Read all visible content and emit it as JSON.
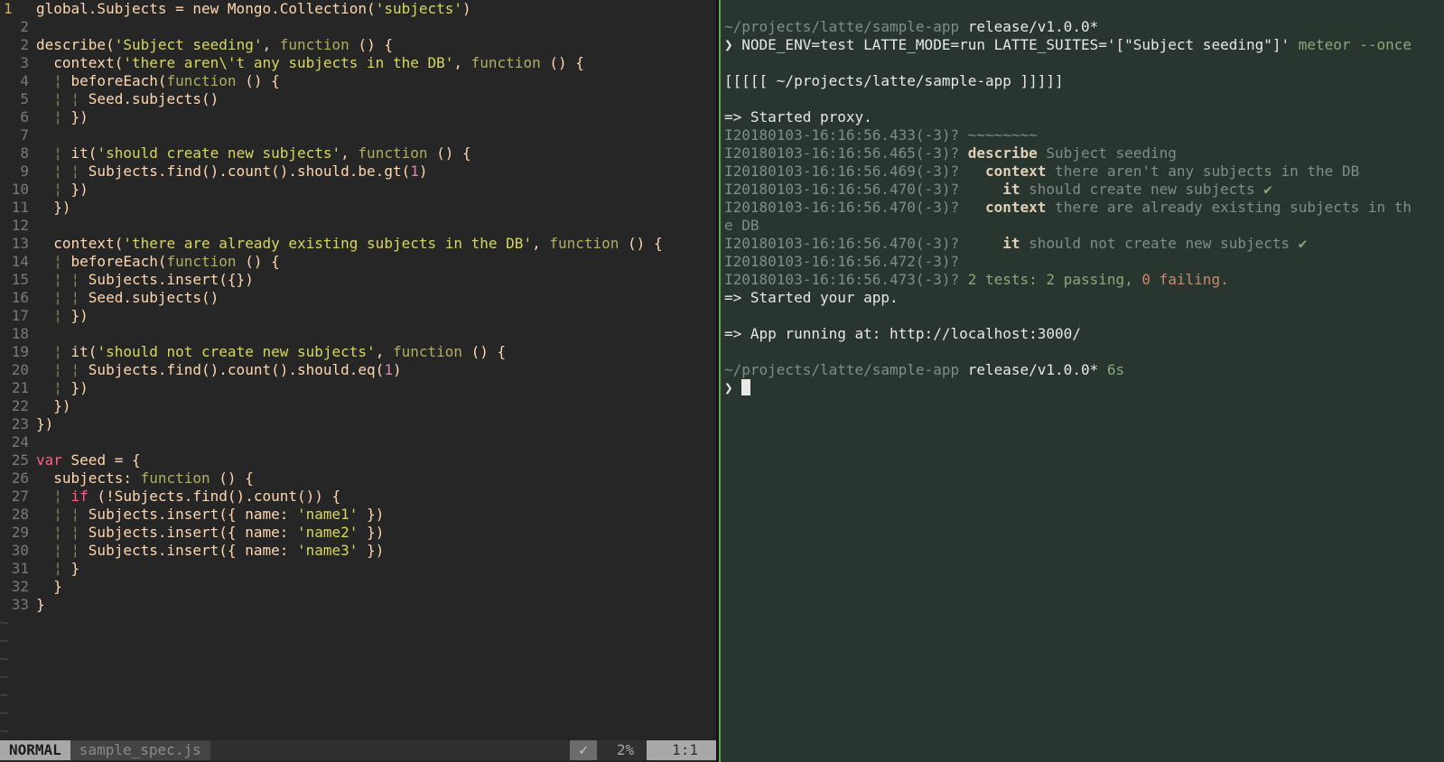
{
  "editor": {
    "current_line": "1",
    "lines": [
      {
        "n": "1",
        "tokens": [
          [
            "t-id",
            "global.Subjects = new Mongo.Collection("
          ],
          [
            "t-str",
            "'subjects'"
          ],
          [
            "t-id",
            ")"
          ]
        ]
      },
      {
        "n": "2",
        "tokens": []
      },
      {
        "n": "2",
        "tokens": [
          [
            "t-id",
            "describe("
          ],
          [
            "t-str",
            "'Subject seeding'"
          ],
          [
            "t-id",
            ", "
          ],
          [
            "t-fn",
            "function"
          ],
          [
            "t-id",
            " () {"
          ]
        ]
      },
      {
        "n": "3",
        "tokens": [
          [
            "t-id",
            "  context("
          ],
          [
            "t-str",
            "'there aren\\'t any subjects in the DB'"
          ],
          [
            "t-id",
            ", "
          ],
          [
            "t-fn",
            "function"
          ],
          [
            "t-id",
            " () {"
          ]
        ]
      },
      {
        "n": "4",
        "tokens": [
          [
            "t-guide",
            "  ¦ "
          ],
          [
            "t-id",
            "beforeEach("
          ],
          [
            "t-fn",
            "function"
          ],
          [
            "t-id",
            " () {"
          ]
        ]
      },
      {
        "n": "5",
        "tokens": [
          [
            "t-guide",
            "  ¦ ¦ "
          ],
          [
            "t-id",
            "Seed.subjects()"
          ]
        ]
      },
      {
        "n": "6",
        "tokens": [
          [
            "t-guide",
            "  ¦ "
          ],
          [
            "t-id",
            "})"
          ]
        ]
      },
      {
        "n": "7",
        "tokens": []
      },
      {
        "n": "8",
        "tokens": [
          [
            "t-guide",
            "  ¦ "
          ],
          [
            "t-id",
            "it("
          ],
          [
            "t-str",
            "'should create new subjects'"
          ],
          [
            "t-id",
            ", "
          ],
          [
            "t-fn",
            "function"
          ],
          [
            "t-id",
            " () {"
          ]
        ]
      },
      {
        "n": "9",
        "tokens": [
          [
            "t-guide",
            "  ¦ ¦ "
          ],
          [
            "t-id",
            "Subjects.find().count().should.be.gt("
          ],
          [
            "t-num",
            "1"
          ],
          [
            "t-id",
            ")"
          ]
        ]
      },
      {
        "n": "10",
        "tokens": [
          [
            "t-guide",
            "  ¦ "
          ],
          [
            "t-id",
            "})"
          ]
        ]
      },
      {
        "n": "11",
        "tokens": [
          [
            "t-id",
            "  })"
          ]
        ]
      },
      {
        "n": "12",
        "tokens": []
      },
      {
        "n": "13",
        "tokens": [
          [
            "t-id",
            "  context("
          ],
          [
            "t-str",
            "'there are already existing subjects in the DB'"
          ],
          [
            "t-id",
            ", "
          ],
          [
            "t-fn",
            "function"
          ],
          [
            "t-id",
            " () {"
          ]
        ]
      },
      {
        "n": "14",
        "tokens": [
          [
            "t-guide",
            "  ¦ "
          ],
          [
            "t-id",
            "beforeEach("
          ],
          [
            "t-fn",
            "function"
          ],
          [
            "t-id",
            " () {"
          ]
        ]
      },
      {
        "n": "15",
        "tokens": [
          [
            "t-guide",
            "  ¦ ¦ "
          ],
          [
            "t-id",
            "Subjects.insert({})"
          ]
        ]
      },
      {
        "n": "16",
        "tokens": [
          [
            "t-guide",
            "  ¦ ¦ "
          ],
          [
            "t-id",
            "Seed.subjects()"
          ]
        ]
      },
      {
        "n": "17",
        "tokens": [
          [
            "t-guide",
            "  ¦ "
          ],
          [
            "t-id",
            "})"
          ]
        ]
      },
      {
        "n": "18",
        "tokens": []
      },
      {
        "n": "19",
        "tokens": [
          [
            "t-guide",
            "  ¦ "
          ],
          [
            "t-id",
            "it("
          ],
          [
            "t-str",
            "'should not create new subjects'"
          ],
          [
            "t-id",
            ", "
          ],
          [
            "t-fn",
            "function"
          ],
          [
            "t-id",
            " () {"
          ]
        ]
      },
      {
        "n": "20",
        "tokens": [
          [
            "t-guide",
            "  ¦ ¦ "
          ],
          [
            "t-id",
            "Subjects.find().count().should.eq("
          ],
          [
            "t-num",
            "1"
          ],
          [
            "t-id",
            ")"
          ]
        ]
      },
      {
        "n": "21",
        "tokens": [
          [
            "t-guide",
            "  ¦ "
          ],
          [
            "t-id",
            "})"
          ]
        ]
      },
      {
        "n": "22",
        "tokens": [
          [
            "t-id",
            "  })"
          ]
        ]
      },
      {
        "n": "23",
        "tokens": [
          [
            "t-id",
            "})"
          ]
        ]
      },
      {
        "n": "24",
        "tokens": []
      },
      {
        "n": "25",
        "tokens": [
          [
            "t-kw",
            "var"
          ],
          [
            "t-id",
            " Seed = {"
          ]
        ]
      },
      {
        "n": "26",
        "tokens": [
          [
            "t-id",
            "  subjects: "
          ],
          [
            "t-fn",
            "function"
          ],
          [
            "t-id",
            " () {"
          ]
        ]
      },
      {
        "n": "27",
        "tokens": [
          [
            "t-guide",
            "  ¦ "
          ],
          [
            "t-kw",
            "if"
          ],
          [
            "t-id",
            " (!Subjects.find().count()) {"
          ]
        ]
      },
      {
        "n": "28",
        "tokens": [
          [
            "t-guide",
            "  ¦ ¦ "
          ],
          [
            "t-id",
            "Subjects.insert({ name: "
          ],
          [
            "t-str",
            "'name1'"
          ],
          [
            "t-id",
            " })"
          ]
        ]
      },
      {
        "n": "29",
        "tokens": [
          [
            "t-guide",
            "  ¦ ¦ "
          ],
          [
            "t-id",
            "Subjects.insert({ name: "
          ],
          [
            "t-str",
            "'name2'"
          ],
          [
            "t-id",
            " })"
          ]
        ]
      },
      {
        "n": "30",
        "tokens": [
          [
            "t-guide",
            "  ¦ ¦ "
          ],
          [
            "t-id",
            "Subjects.insert({ name: "
          ],
          [
            "t-str",
            "'name3'"
          ],
          [
            "t-id",
            " })"
          ]
        ]
      },
      {
        "n": "31",
        "tokens": [
          [
            "t-guide",
            "  ¦ "
          ],
          [
            "t-id",
            "}"
          ]
        ]
      },
      {
        "n": "32",
        "tokens": [
          [
            "t-id",
            "  }"
          ]
        ]
      },
      {
        "n": "33",
        "tokens": [
          [
            "t-id",
            "}"
          ]
        ]
      }
    ],
    "tilde_char": "~",
    "tilde_count": 8
  },
  "statusline": {
    "mode": "NORMAL",
    "filename": "sample_spec.js",
    "check": "✓",
    "percent": "2%",
    "position": "1:1"
  },
  "terminal": {
    "lines": [
      {
        "segs": [
          [
            "muted",
            "~/projects/latte/sample-app "
          ],
          [
            "white",
            "release/v1.0.0*"
          ]
        ]
      },
      {
        "segs": [
          [
            "prompt-sym",
            "❯ "
          ],
          [
            "white",
            "NODE_ENV=test LATTE_MODE=run LATTE_SUITES='[\"Subject seeding\"]' "
          ],
          [
            "cmdarg",
            "meteor --once"
          ]
        ]
      },
      {
        "segs": []
      },
      {
        "segs": [
          [
            "white",
            "[[[[[ ~/projects/latte/sample-app ]]]]]"
          ]
        ]
      },
      {
        "segs": []
      },
      {
        "segs": [
          [
            "white",
            "=> Started proxy."
          ]
        ]
      },
      {
        "segs": [
          [
            "muted",
            "I20180103-16:16:56.433(-3)? ~~~~~~~~"
          ]
        ]
      },
      {
        "segs": [
          [
            "muted",
            "I20180103-16:16:56.465(-3)? "
          ],
          [
            "bold",
            "describe"
          ],
          [
            "muted",
            " Subject seeding"
          ]
        ]
      },
      {
        "segs": [
          [
            "muted",
            "I20180103-16:16:56.469(-3)?   "
          ],
          [
            "bold",
            "context"
          ],
          [
            "muted",
            " there aren't any subjects in the DB"
          ]
        ]
      },
      {
        "segs": [
          [
            "muted",
            "I20180103-16:16:56.470(-3)?     "
          ],
          [
            "bold",
            "it"
          ],
          [
            "muted",
            " should create new subjects "
          ],
          [
            "green",
            "✔"
          ]
        ]
      },
      {
        "segs": [
          [
            "muted",
            "I20180103-16:16:56.470(-3)?   "
          ],
          [
            "bold",
            "context"
          ],
          [
            "muted",
            " there are already existing subjects in th"
          ]
        ]
      },
      {
        "segs": [
          [
            "muted",
            "e DB"
          ]
        ]
      },
      {
        "segs": [
          [
            "muted",
            "I20180103-16:16:56.470(-3)?     "
          ],
          [
            "bold",
            "it"
          ],
          [
            "muted",
            " should not create new subjects "
          ],
          [
            "green",
            "✔"
          ]
        ]
      },
      {
        "segs": [
          [
            "muted",
            "I20180103-16:16:56.472(-3)?"
          ]
        ]
      },
      {
        "segs": [
          [
            "muted",
            "I20180103-16:16:56.473(-3)? "
          ],
          [
            "green",
            "2 tests: 2 passing, "
          ],
          [
            "orange",
            "0 failing."
          ]
        ]
      },
      {
        "segs": [
          [
            "white",
            "=> Started your app."
          ]
        ]
      },
      {
        "segs": []
      },
      {
        "segs": [
          [
            "white",
            "=> App running at: http://localhost:3000/"
          ]
        ]
      },
      {
        "segs": []
      },
      {
        "segs": [
          [
            "muted",
            "~/projects/latte/sample-app "
          ],
          [
            "white",
            "release/v1.0.0* "
          ],
          [
            "green",
            "6s"
          ]
        ]
      }
    ],
    "prompt_symbol": "❯"
  }
}
